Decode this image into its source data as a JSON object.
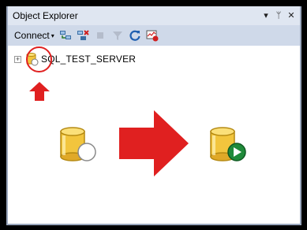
{
  "panel": {
    "title": "Object Explorer",
    "pin_glyph": "▾",
    "autohide_glyph": "ᛘ",
    "close_glyph": "✕"
  },
  "toolbar": {
    "connect_label": "Connect",
    "connect_caret": "▾",
    "icons": [
      "connect-object-explorer-icon",
      "disconnect-icon",
      "stop-icon",
      "filter-icon",
      "refresh-icon",
      "activity-monitor-icon"
    ]
  },
  "tree": {
    "expander": "+",
    "server_name": "SQL_TEST_SERVER"
  },
  "colors": {
    "title_bg": "#dfe6f1",
    "toolbar_bg": "#cfd9e9",
    "annotation_red": "#e02020",
    "db_yellow": "#f2c53d",
    "running_green": "#1f8a3a"
  }
}
